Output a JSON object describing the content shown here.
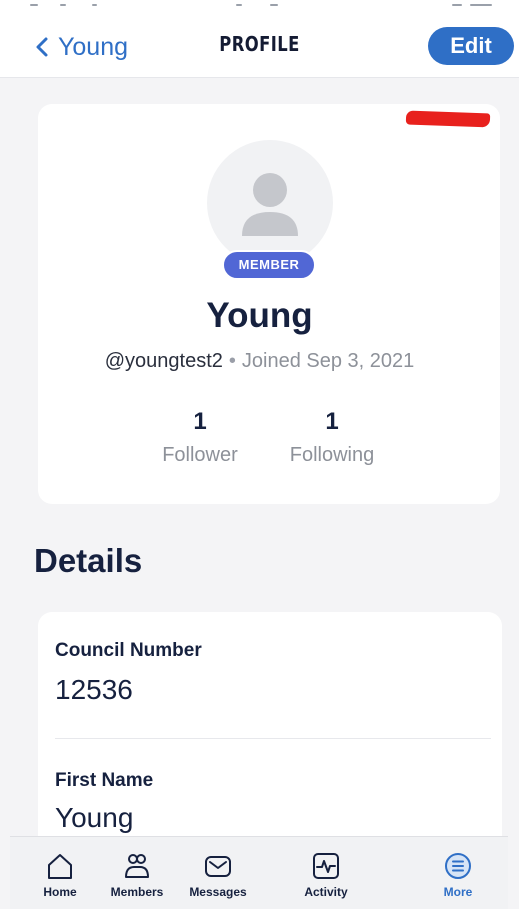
{
  "nav": {
    "back_label": "Young",
    "title": "PROFILE",
    "edit_label": "Edit"
  },
  "profile": {
    "badge": "MEMBER",
    "name": "Young",
    "handle": "@youngtest2",
    "separator": "•",
    "joined": "Joined Sep 3, 2021",
    "stats": [
      {
        "value": "1",
        "label": "Follower"
      },
      {
        "value": "1",
        "label": "Following"
      }
    ]
  },
  "details": {
    "title": "Details",
    "fields": [
      {
        "label": "Council Number",
        "value": "12536"
      },
      {
        "label": "First Name",
        "value": "Young"
      }
    ]
  },
  "tabs": [
    {
      "label": "Home",
      "icon": "home-icon"
    },
    {
      "label": "Members",
      "icon": "members-icon"
    },
    {
      "label": "Messages",
      "icon": "messages-icon"
    },
    {
      "label": "Activity",
      "icon": "activity-icon"
    },
    {
      "label": "More",
      "icon": "more-icon",
      "active": true
    }
  ],
  "colors": {
    "accent": "#2f6fc6",
    "badge": "#5167d5",
    "text": "#16213f",
    "redaction": "#e8211d"
  }
}
